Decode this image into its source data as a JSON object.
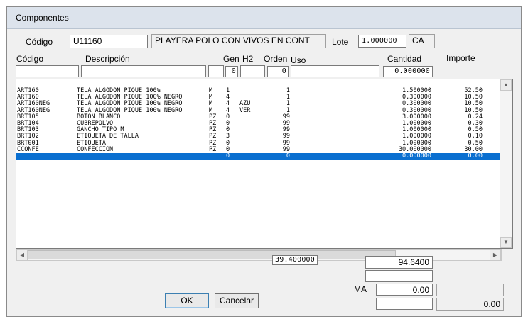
{
  "window": {
    "title": "Componentes"
  },
  "header": {
    "codigo_label": "Código",
    "codigo_value": "U11160",
    "descripcion_value": "PLAYERA POLO CON VIVOS EN CONT",
    "lote_label": "Lote",
    "lote_value": "1.000000",
    "unidad_value": "CA"
  },
  "columns": {
    "codigo": "Código",
    "descripcion": "Descripción",
    "gen": "Gen",
    "h2": "H2",
    "orden": "Orden",
    "uso": "Uso",
    "cantidad": "Cantidad",
    "importe": "Importe"
  },
  "filters": {
    "codigo": "",
    "descripcion": "",
    "unidad": "",
    "gen": "0",
    "h2": "",
    "orden": "0",
    "uso": "",
    "cantidad": "0.000000"
  },
  "rows": [
    {
      "codigo": "ART160",
      "descripcion": "TELA ALGODON PIQUE 100%",
      "um": "M",
      "gen": "1",
      "h2": "",
      "orden": "1",
      "cantidad": "1.500000",
      "importe": "52.50"
    },
    {
      "codigo": "ART160",
      "descripcion": "TELA ALGODON PIQUE 100% NEGRO",
      "um": "M",
      "gen": "4",
      "h2": "",
      "orden": "1",
      "cantidad": "0.300000",
      "importe": "10.50"
    },
    {
      "codigo": "ART160NEG",
      "descripcion": "TELA ALGODON PIQUE 100% NEGRO",
      "um": "M",
      "gen": "4",
      "h2": "AZU",
      "orden": "1",
      "cantidad": "0.300000",
      "importe": "10.50"
    },
    {
      "codigo": "ART160NEG",
      "descripcion": "TELA ALGODON PIQUE 100% NEGRO",
      "um": "M",
      "gen": "4",
      "h2": "VER",
      "orden": "1",
      "cantidad": "0.300000",
      "importe": "10.50"
    },
    {
      "codigo": "BRT105",
      "descripcion": "BOTON BLANCO",
      "um": "PZ",
      "gen": "0",
      "h2": "",
      "orden": "99",
      "cantidad": "3.000000",
      "importe": "0.24"
    },
    {
      "codigo": "BRT104",
      "descripcion": "CUBREPOLVO",
      "um": "PZ",
      "gen": "0",
      "h2": "",
      "orden": "99",
      "cantidad": "1.000000",
      "importe": "0.30"
    },
    {
      "codigo": "BRT103",
      "descripcion": "GANCHO TIPO M",
      "um": "PZ",
      "gen": "0",
      "h2": "",
      "orden": "99",
      "cantidad": "1.000000",
      "importe": "0.50"
    },
    {
      "codigo": "BRT102",
      "descripcion": "ETIQUETA DE TALLA",
      "um": "PZ",
      "gen": "3",
      "h2": "",
      "orden": "99",
      "cantidad": "1.000000",
      "importe": "0.10"
    },
    {
      "codigo": "BRT001",
      "descripcion": "ETIQUETA",
      "um": "PZ",
      "gen": "0",
      "h2": "",
      "orden": "99",
      "cantidad": "1.000000",
      "importe": "0.50"
    },
    {
      "codigo": "CCONFE",
      "descripcion": "CONFECCION",
      "um": "PZ",
      "gen": "0",
      "h2": "",
      "orden": "99",
      "cantidad": "30.000000",
      "importe": "30.00"
    },
    {
      "codigo": "",
      "descripcion": "",
      "um": "",
      "gen": "0",
      "h2": "",
      "orden": "0",
      "cantidad": "0.000000",
      "importe": "0.00",
      "selected": true
    }
  ],
  "totals": {
    "cantidad_total": "39.400000",
    "importe_total": "94.6400",
    "ma_label": "MA",
    "ma_value": "0.00",
    "bottom_value": "0.00"
  },
  "buttons": {
    "ok": "OK",
    "cancel": "Cancelar"
  },
  "colors": {
    "selection": "#0a6fd0",
    "titlebar": "#dce3ec"
  }
}
